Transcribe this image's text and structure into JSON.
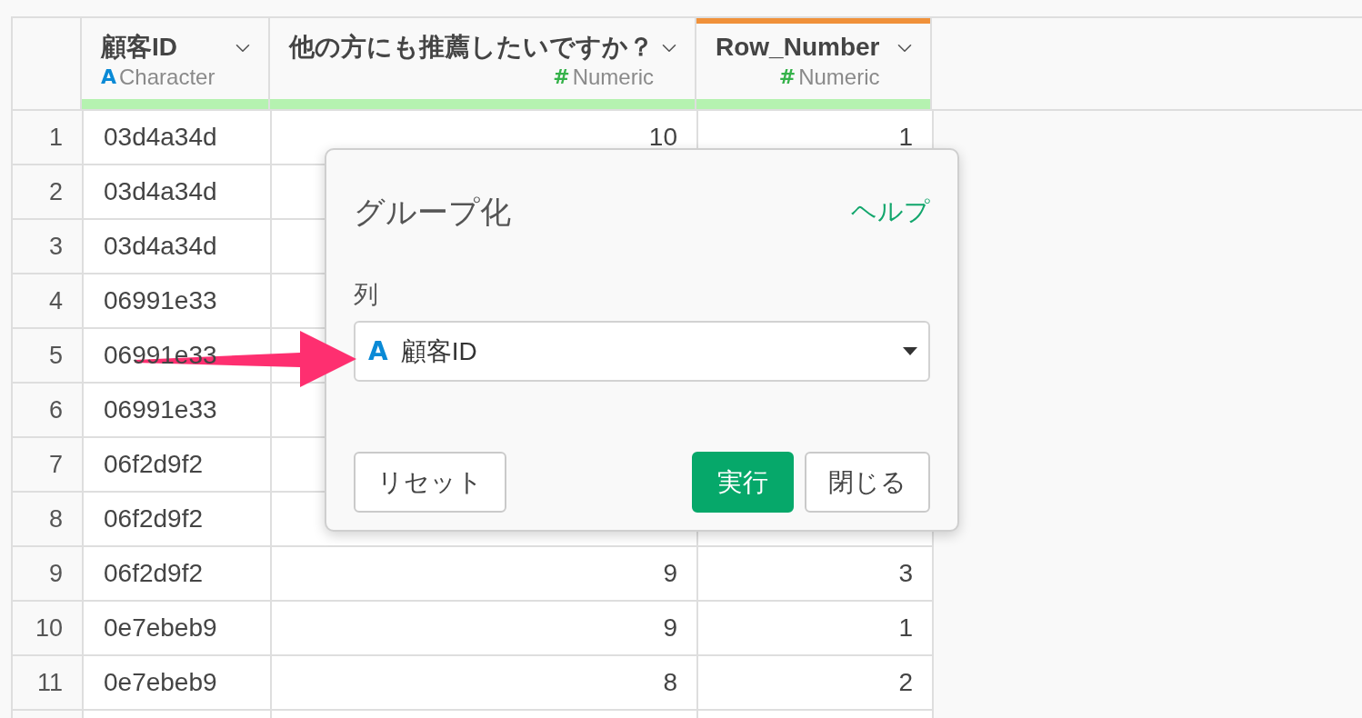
{
  "table": {
    "columns": [
      {
        "name": "顧客ID",
        "type_icon": "A",
        "type": "Character",
        "kind": "character",
        "selected": false,
        "level": 1
      },
      {
        "name": "他の方にも推薦したいですか？",
        "type_icon": "#",
        "type": "Numeric",
        "kind": "numeric",
        "selected": false,
        "level": 1
      },
      {
        "name": "Row_Number",
        "type_icon": "#",
        "type": "Numeric",
        "kind": "numeric",
        "selected": true,
        "level": 1
      }
    ],
    "rows": [
      {
        "number": "1",
        "cells": [
          "03d4a34d",
          "10",
          "1"
        ]
      },
      {
        "number": "2",
        "cells": [
          "03d4a34d"
        ]
      },
      {
        "number": "3",
        "cells": [
          "03d4a34d"
        ]
      },
      {
        "number": "4",
        "cells": [
          "06991e33"
        ]
      },
      {
        "number": "5",
        "cells": [
          "06991e33"
        ]
      },
      {
        "number": "6",
        "cells": [
          "06991e33"
        ]
      },
      {
        "number": "7",
        "cells": [
          "06f2d9f2"
        ]
      },
      {
        "number": "8",
        "cells": [
          "06f2d9f2"
        ]
      },
      {
        "number": "9",
        "cells": [
          "06f2d9f2",
          "9",
          "3"
        ]
      },
      {
        "number": "10",
        "cells": [
          "0e7ebeb9",
          "9",
          "1"
        ]
      },
      {
        "number": "11",
        "cells": [
          "0e7ebeb9",
          "8",
          "2"
        ]
      }
    ]
  },
  "dialog": {
    "title": "グループ化",
    "help_link": "ヘルプ",
    "field_label": "列",
    "column_select": {
      "type_icon": "A",
      "kind": "character",
      "value": "顧客ID"
    },
    "left_buttons": [
      {
        "label": "リセット",
        "kind": "secondary"
      }
    ],
    "right_buttons": [
      {
        "label": "実行",
        "kind": "primary"
      },
      {
        "label": "閉じる",
        "kind": "secondary"
      }
    ]
  }
}
